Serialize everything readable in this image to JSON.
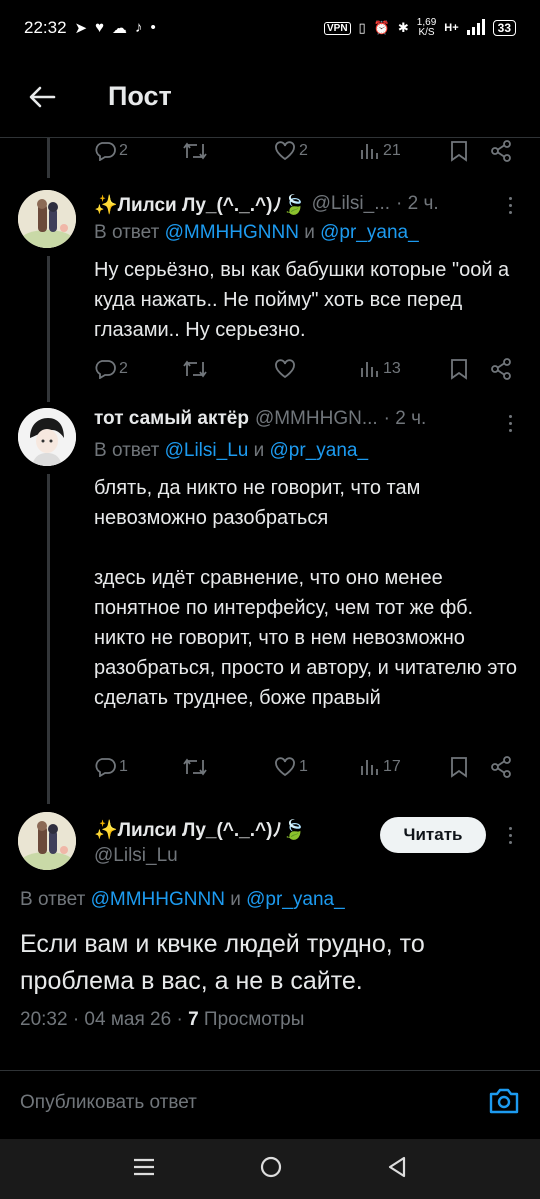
{
  "status_bar": {
    "time": "22:32",
    "left_icons": [
      "telegram-icon",
      "heart-icon",
      "cloud-icon",
      "tiktok-icon",
      "dot-icon"
    ],
    "vpn": "VPN",
    "speed_value": "1,69",
    "speed_unit": "K/S",
    "network": "H+",
    "battery": "33"
  },
  "header": {
    "title": "Пост"
  },
  "top_actions": {
    "replies": "2",
    "retweets": "",
    "likes": "2",
    "views": "21"
  },
  "reply1": {
    "name": "✨Лилси Лу_(^._.^)ﾉ🍃",
    "handle": "@Lilsi_...",
    "time": "· 2 ч.",
    "reply_prefix": "В ответ",
    "mention1": "@MMHHGNNN",
    "conj": "и",
    "mention2": "@pr_yana_",
    "text": "Ну серьёзно, вы как бабушки которые \"оой а куда нажать.. Не пойму\" хоть все перед глазами.. Ну серьезно.",
    "replies": "2",
    "views": "13"
  },
  "reply2": {
    "name": "тот самый актёр",
    "handle": "@MMHHGN...",
    "time": "· 2 ч.",
    "reply_prefix": "В ответ",
    "mention1": "@Lilsi_Lu",
    "conj": "и",
    "mention2": "@pr_yana_",
    "text": "блять, да никто не говорит, что там невозможно разобраться\n\nздесь идёт сравнение, что оно менее понятное по интерфейсу, чем тот же фб. никто не говорит, что в нем невозможно разобраться, просто и автору, и читателю это сделать труднее, боже правый",
    "replies": "1",
    "likes": "1",
    "views": "17"
  },
  "main_post": {
    "name": "✨Лилси Лу_(^._.^)ﾉ🍃",
    "handle": "@Lilsi_Lu",
    "follow_label": "Читать",
    "reply_prefix": "В ответ",
    "mention1": "@MMHHGNNN",
    "conj": "и",
    "mention2": "@pr_yana_",
    "text": "Если вам и квчке людей трудно, то проблема в вас, а не в сайте.",
    "timestamp": "20:32 · 04 мая 26 ·",
    "views_count": "7",
    "views_label": "Просмотры"
  },
  "composer": {
    "placeholder": "Опубликовать ответ"
  },
  "colors": {
    "background": "#000000",
    "text": "#e7e9ea",
    "muted": "#71767b",
    "link": "#1d9bf0",
    "divider": "#2f3336"
  }
}
